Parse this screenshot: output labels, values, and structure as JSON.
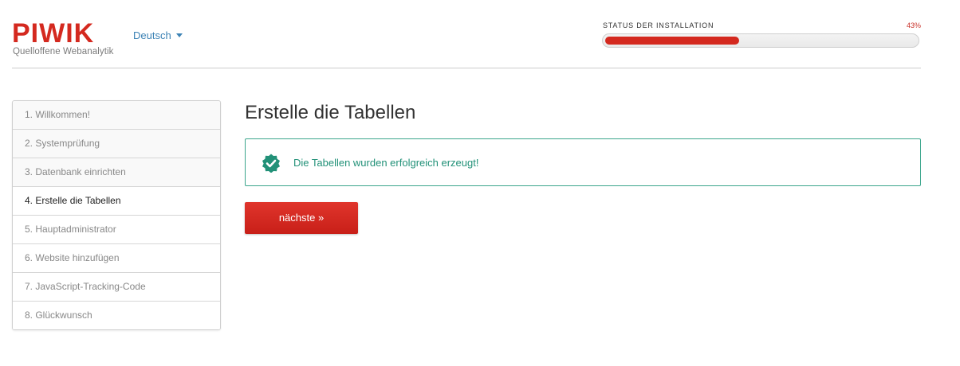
{
  "header": {
    "logo_text": "PIWIK",
    "tagline": "Quelloffene Webanalytik",
    "language": "Deutsch",
    "status_label": "STATUS DER INSTALLATION",
    "status_percent_text": "43%",
    "progress": 0.43
  },
  "steps": [
    {
      "label": "1. Willkommen!",
      "state": "done"
    },
    {
      "label": "2. Systemprüfung",
      "state": "done"
    },
    {
      "label": "3. Datenbank einrichten",
      "state": "done"
    },
    {
      "label": "4. Erstelle die Tabellen",
      "state": "active"
    },
    {
      "label": "5. Hauptadministrator",
      "state": "future"
    },
    {
      "label": "6. Website hinzufügen",
      "state": "future"
    },
    {
      "label": "7. JavaScript-Tracking-Code",
      "state": "future"
    },
    {
      "label": "8. Glückwunsch",
      "state": "future"
    }
  ],
  "main": {
    "title": "Erstelle die Tabellen",
    "success_message": "Die Tabellen wurden erfolgreich erzeugt!",
    "next_label": "nächste »"
  },
  "colors": {
    "brand_red": "#d4291f",
    "success_green": "#229178",
    "link_blue": "#3d83b5"
  },
  "icons": {
    "success": "check-badge-icon",
    "language": "caret-down-icon"
  }
}
